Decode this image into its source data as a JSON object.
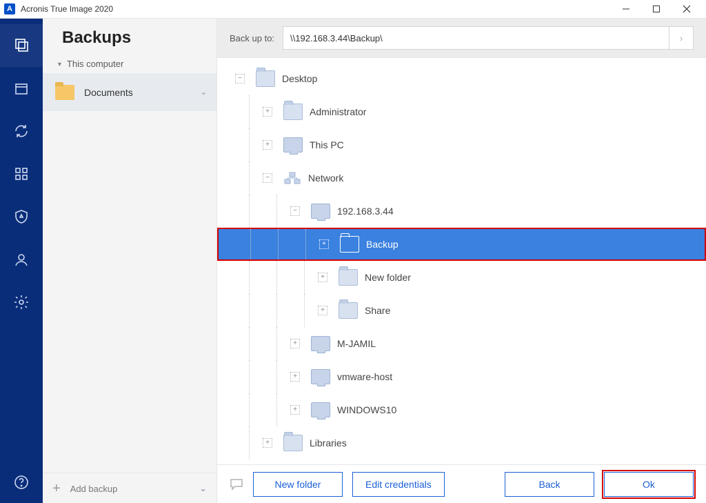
{
  "window": {
    "title": "Acronis True Image 2020",
    "app_badge": "A"
  },
  "sidebar": {
    "heading": "Backups",
    "group": "This computer",
    "item": "Documents",
    "add_label": "Add backup"
  },
  "toolbar": {
    "label": "Back up to:",
    "path": "\\\\192.168.3.44\\Backup\\"
  },
  "tree": {
    "desktop": "Desktop",
    "admin": "Administrator",
    "thispc": "This PC",
    "network": "Network",
    "host1": "192.168.3.44",
    "host1_backup": "Backup",
    "host1_newfolder": "New folder",
    "host1_share": "Share",
    "host2": "M-JAMIL",
    "host3": "vmware-host",
    "host4": "WINDOWS10",
    "libraries": "Libraries"
  },
  "buttons": {
    "new_folder": "New folder",
    "edit_creds": "Edit credentials",
    "back": "Back",
    "ok": "Ok"
  }
}
